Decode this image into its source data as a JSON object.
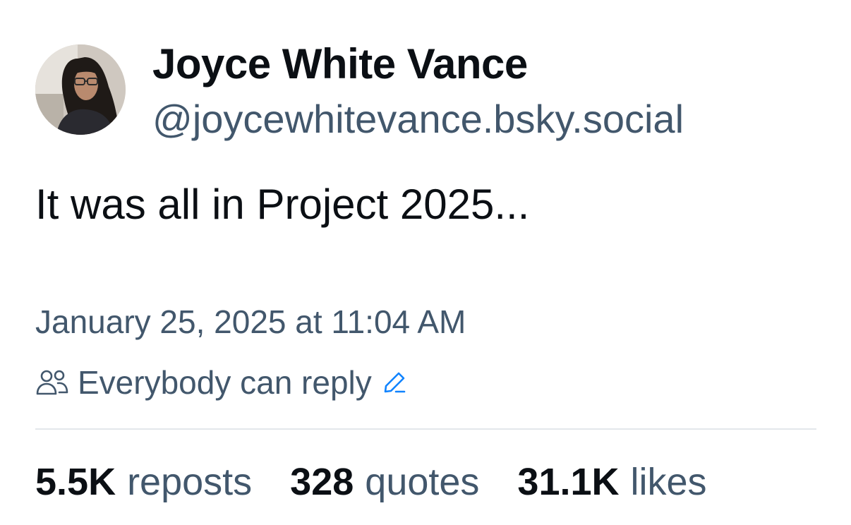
{
  "post": {
    "author": {
      "display_name": "Joyce White Vance",
      "handle": "@joycewhitevance.bsky.social",
      "avatar_icon": "avatar-photo"
    },
    "text": "It was all in Project 2025...",
    "timestamp": "January 25, 2025 at 11:04 AM",
    "reply_setting": {
      "icon": "people-icon",
      "label": "Everybody can reply",
      "edit_icon": "pencil-icon",
      "edit_color": "#1083fe"
    },
    "stats": [
      {
        "count": "5.5K",
        "label": "reposts"
      },
      {
        "count": "328",
        "label": "quotes"
      },
      {
        "count": "31.1K",
        "label": "likes"
      }
    ]
  },
  "colors": {
    "text_primary": "#0b0f14",
    "text_secondary": "#42576c",
    "divider": "#e3e7eb",
    "accent": "#1083fe"
  }
}
